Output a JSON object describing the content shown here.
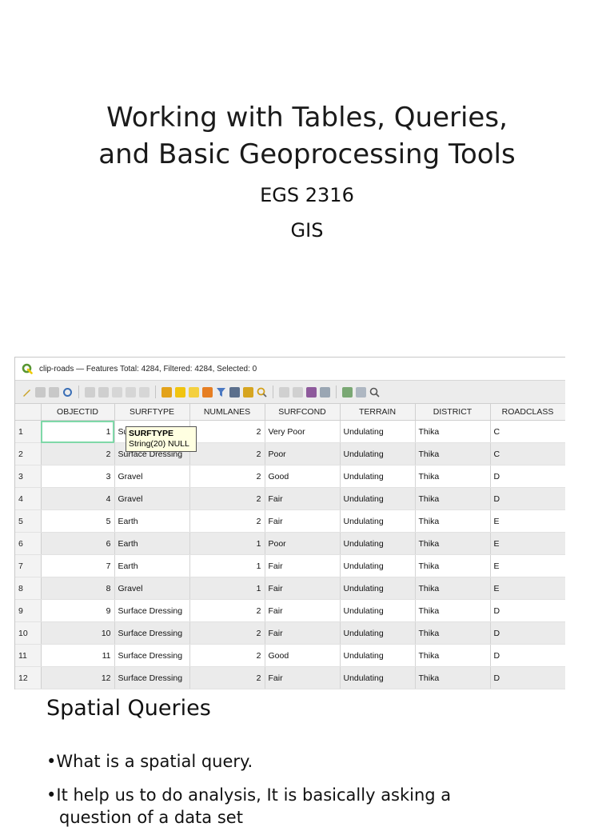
{
  "slide": {
    "title_line1": "Working with Tables, Queries,",
    "title_line2": "and Basic Geoprocessing Tools",
    "course": "EGS 2316",
    "subject": "GIS"
  },
  "window": {
    "title": "clip-roads — Features Total: 4284, Filtered: 4284, Selected: 0"
  },
  "table": {
    "columns": [
      "OBJECTID",
      "SURFTYPE",
      "NUMLANES",
      "SURFCOND",
      "TERRAIN",
      "DISTRICT",
      "ROADCLASS"
    ],
    "rows": [
      {
        "n": "1",
        "objectid": "1",
        "surftype": "Surface Dressing",
        "numlanes": "2",
        "surfcond": "Very Poor",
        "terrain": "Undulating",
        "district": "Thika",
        "roadclass": "C"
      },
      {
        "n": "2",
        "objectid": "2",
        "surftype": "Surface Dressing",
        "numlanes": "2",
        "surfcond": "Poor",
        "terrain": "Undulating",
        "district": "Thika",
        "roadclass": "C"
      },
      {
        "n": "3",
        "objectid": "3",
        "surftype": "Gravel",
        "numlanes": "2",
        "surfcond": "Good",
        "terrain": "Undulating",
        "district": "Thika",
        "roadclass": "D"
      },
      {
        "n": "4",
        "objectid": "4",
        "surftype": "Gravel",
        "numlanes": "2",
        "surfcond": "Fair",
        "terrain": "Undulating",
        "district": "Thika",
        "roadclass": "D"
      },
      {
        "n": "5",
        "objectid": "5",
        "surftype": "Earth",
        "numlanes": "2",
        "surfcond": "Fair",
        "terrain": "Undulating",
        "district": "Thika",
        "roadclass": "E"
      },
      {
        "n": "6",
        "objectid": "6",
        "surftype": "Earth",
        "numlanes": "1",
        "surfcond": "Poor",
        "terrain": "Undulating",
        "district": "Thika",
        "roadclass": "E"
      },
      {
        "n": "7",
        "objectid": "7",
        "surftype": "Earth",
        "numlanes": "1",
        "surfcond": "Fair",
        "terrain": "Undulating",
        "district": "Thika",
        "roadclass": "E"
      },
      {
        "n": "8",
        "objectid": "8",
        "surftype": "Gravel",
        "numlanes": "1",
        "surfcond": "Fair",
        "terrain": "Undulating",
        "district": "Thika",
        "roadclass": "E"
      },
      {
        "n": "9",
        "objectid": "9",
        "surftype": "Surface Dressing",
        "numlanes": "2",
        "surfcond": "Fair",
        "terrain": "Undulating",
        "district": "Thika",
        "roadclass": "D"
      },
      {
        "n": "10",
        "objectid": "10",
        "surftype": "Surface Dressing",
        "numlanes": "2",
        "surfcond": "Fair",
        "terrain": "Undulating",
        "district": "Thika",
        "roadclass": "D"
      },
      {
        "n": "11",
        "objectid": "11",
        "surftype": "Surface Dressing",
        "numlanes": "2",
        "surfcond": "Good",
        "terrain": "Undulating",
        "district": "Thika",
        "roadclass": "D"
      },
      {
        "n": "12",
        "objectid": "12",
        "surftype": "Surface Dressing",
        "numlanes": "2",
        "surfcond": "Fair",
        "terrain": "Undulating",
        "district": "Thika",
        "roadclass": "D"
      }
    ]
  },
  "tooltip": {
    "field": "SURFTYPE",
    "type": "String(20) NULL"
  },
  "body": {
    "heading": "Spatial Queries",
    "bullet1": "What is a spatial query.",
    "bullet2": "It help us to do analysis, It is basically asking a",
    "bullet2_cont": "question of a data set"
  },
  "colors": {
    "qgis_green": "#589632",
    "qgis_yellow": "#eec900",
    "selected_cell_outline": "#7fd8a8"
  }
}
